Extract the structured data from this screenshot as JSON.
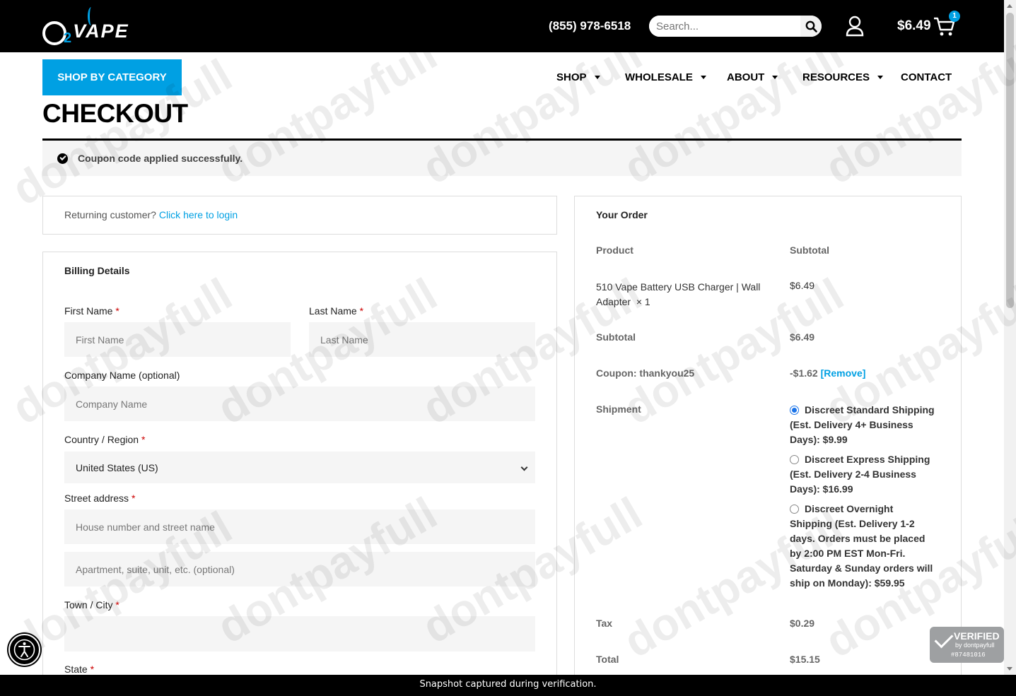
{
  "header": {
    "logo_text": "O2VAPE",
    "logo_sub": "2",
    "logo_word": "VAPE",
    "phone": "(855) 978-6518",
    "search_placeholder": "Search...",
    "cart_total": "$6.49",
    "cart_count": "1"
  },
  "nav": {
    "shop_by_category": "SHOP BY CATEGORY",
    "items": [
      "SHOP",
      "WHOLESALE",
      "ABOUT",
      "RESOURCES",
      "CONTACT"
    ]
  },
  "page_title": "CHECKOUT",
  "notice": "Coupon code applied successfully.",
  "returning": {
    "text": "Returning customer?",
    "link": "Click here to login"
  },
  "billing": {
    "heading": "Billing Details",
    "first_name_label": "First Name",
    "first_name_placeholder": "First Name",
    "last_name_label": "Last Name",
    "last_name_placeholder": "Last Name",
    "company_label": "Company Name (optional)",
    "company_placeholder": "Company Name",
    "country_label": "Country / Region",
    "country_value": "United States (US)",
    "street_label": "Street address",
    "street_placeholder": "House number and street name",
    "apt_placeholder": "Apartment, suite, unit, etc. (optional)",
    "city_label": "Town / City",
    "state_label": "State",
    "required_mark": "*"
  },
  "order": {
    "heading": "Your Order",
    "col_product": "Product",
    "col_subtotal": "Subtotal",
    "item_name": "510 Vape Battery USB Charger | Wall Adapter",
    "item_qty": "× 1",
    "item_price": "$6.49",
    "subtotal_label": "Subtotal",
    "subtotal_value": "$6.49",
    "coupon_label": "Coupon: thankyou25",
    "coupon_value": "-$1.62",
    "coupon_remove": "[Remove]",
    "shipment_label": "Shipment",
    "shipping_options": [
      {
        "label": "Discreet Standard Shipping (Est. Delivery 4+ Business Days): $9.99",
        "selected": true
      },
      {
        "label": "Discreet Express Shipping (Est. Delivery 2-4 Business Days): $16.99",
        "selected": false
      },
      {
        "label": "Discreet Overnight Shipping (Est. Delivery 1-2 days. Orders must be placed by 2:00 PM EST Mon-Fri. Saturday & Sunday orders will ship on Monday): $59.95",
        "selected": false
      }
    ],
    "tax_label": "Tax",
    "tax_value": "$0.29",
    "total_label": "Total",
    "total_value": "$15.15"
  },
  "verified_badge": {
    "title": "VERIFIED",
    "by": "by dontpayfull",
    "id": "#87481016"
  },
  "watermark": "dontpayfull",
  "footer": "Snapshot captured during verification.",
  "colors": {
    "accent": "#00a0e3",
    "header_bg": "#000000",
    "field_bg": "#f5f5f5",
    "required": "#cc0000"
  }
}
